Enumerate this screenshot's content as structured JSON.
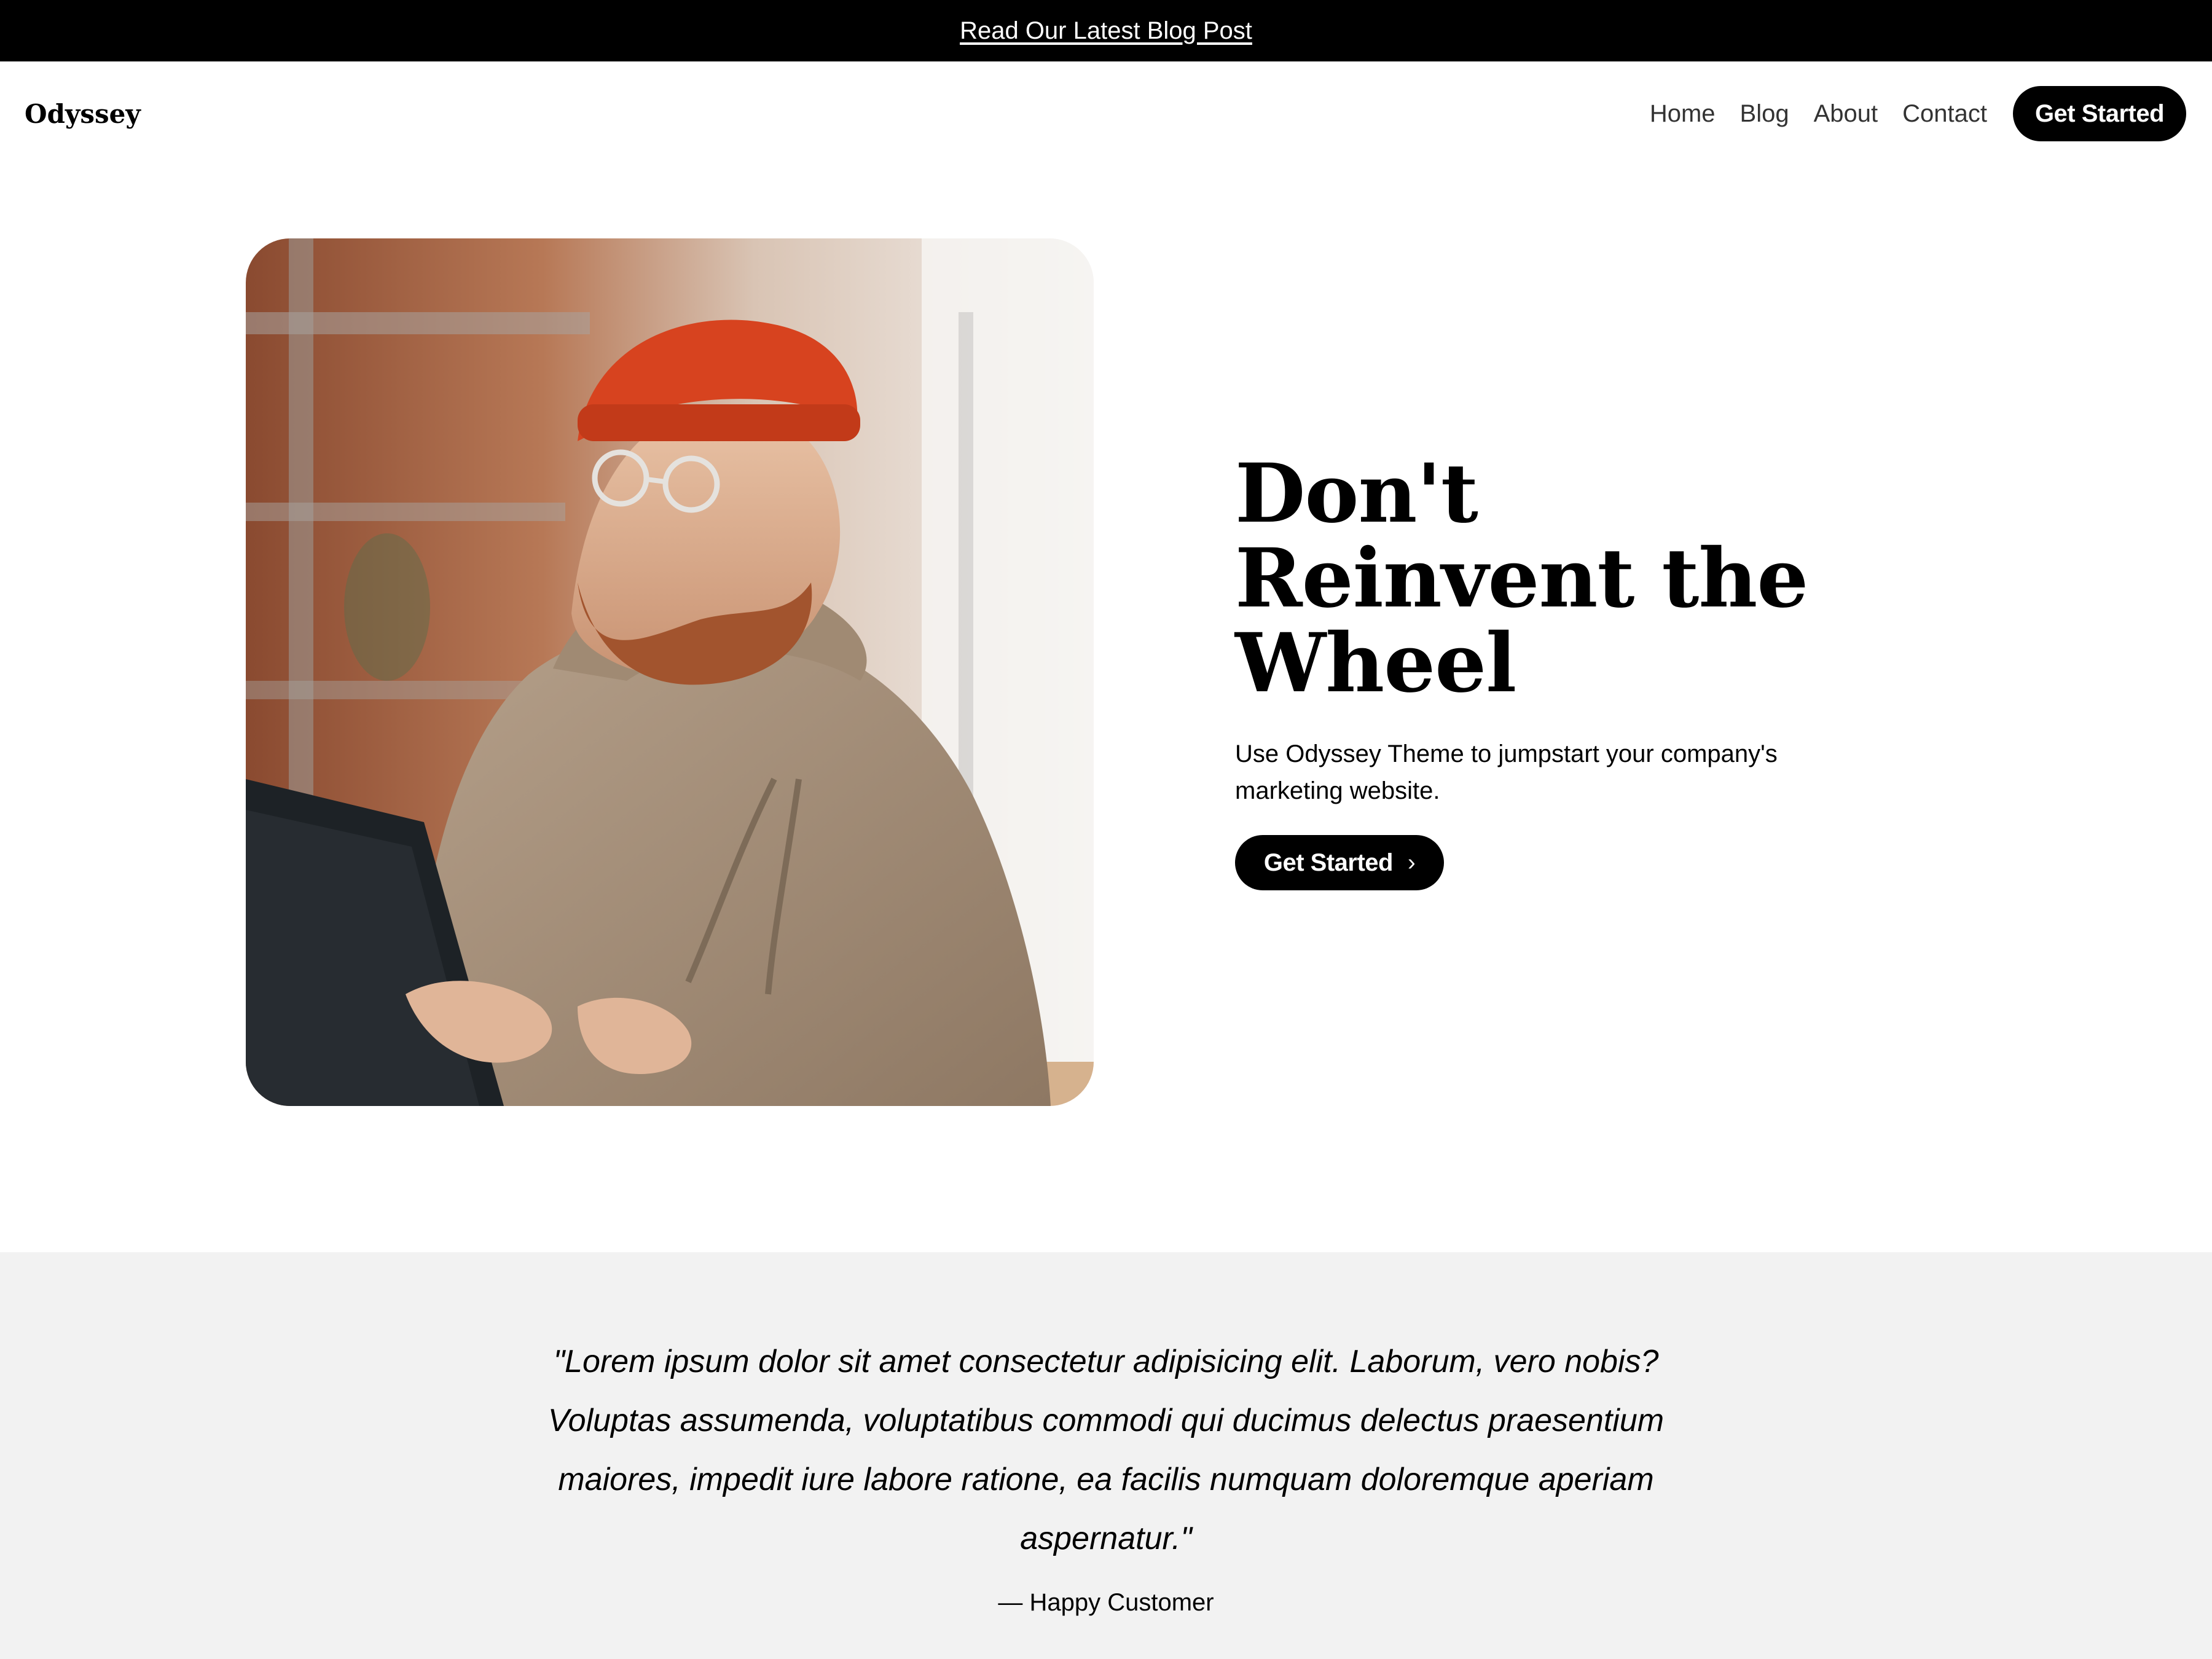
{
  "announcement": {
    "link_text": "Read Our Latest Blog Post"
  },
  "header": {
    "brand": "Odyssey",
    "nav": [
      "Home",
      "Blog",
      "About",
      "Contact"
    ],
    "cta_label": "Get Started"
  },
  "hero": {
    "title_lines": [
      "Don't",
      "Reinvent the",
      "Wheel"
    ],
    "subtitle": "Use Odyssey Theme to jumpstart your company's marketing website.",
    "cta_label": "Get Started",
    "cta_icon": "chevron-right-icon"
  },
  "testimonial": {
    "quote": "\"Lorem ipsum dolor sit amet consectetur adipisicing elit. Laborum, vero nobis? Voluptas assumenda, voluptatibus commodi qui ducimus delectus praesentium maiores, impedit iure labore ratione, ea facilis numquam doloremque aperiam aspernatur.\"",
    "author": "— Happy Customer"
  },
  "colors": {
    "accent": "#000000",
    "background": "#ffffff",
    "testimonial_bg": "#f2f2f2",
    "beanie": "#d7431f",
    "hoodie": "#a8927a"
  }
}
